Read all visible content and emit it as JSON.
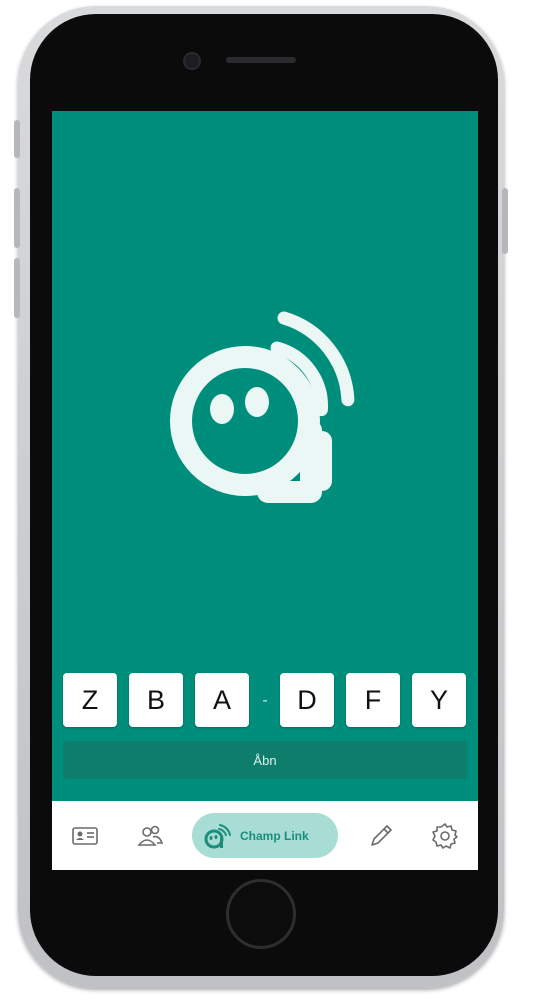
{
  "theme": {
    "accent": "#008e7c",
    "button": "#0f7d6c",
    "pill": "#a7ddd5",
    "tab_icon": "#6b6b6b"
  },
  "code": {
    "characters": [
      "Z",
      "B",
      "A",
      "D",
      "F",
      "Y"
    ],
    "separator": "-"
  },
  "open_button": {
    "label": "Åbn"
  },
  "tabbar": {
    "items": [
      {
        "icon": "id-card-icon"
      },
      {
        "icon": "people-icon"
      },
      {
        "icon": "champ-link-icon",
        "label": "Champ Link",
        "active": true
      },
      {
        "icon": "pencil-icon"
      },
      {
        "icon": "gear-icon"
      }
    ]
  }
}
